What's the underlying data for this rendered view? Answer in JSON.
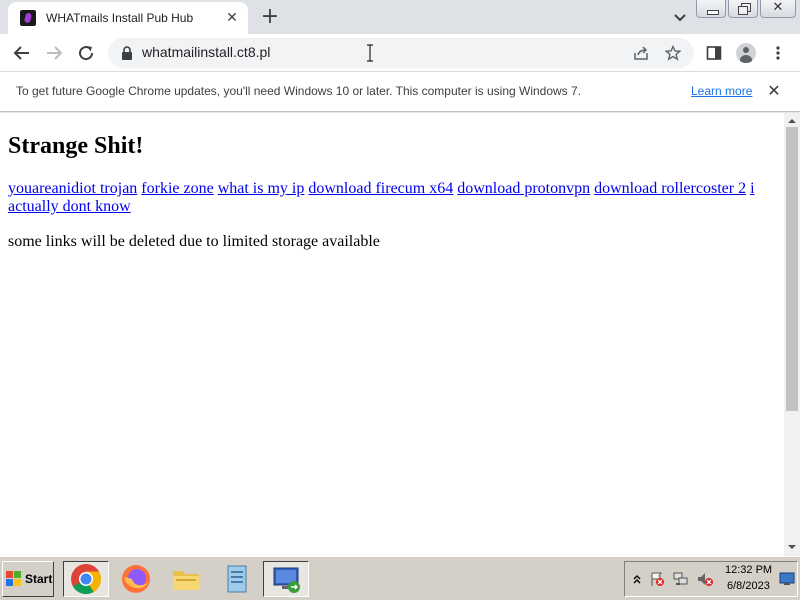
{
  "browser": {
    "tab": {
      "title": "WHATmails Install Pub Hub",
      "close_glyph": "✕",
      "favicon": "site-favicon"
    },
    "new_tab_glyph": "+",
    "window_controls": {
      "close_glyph": "✕"
    },
    "address_bar": {
      "url": "whatmailinstall.ct8.pl"
    },
    "infobar": {
      "message": "To get future Google Chrome updates, you'll need Windows 10 or later. This computer is using Windows 7.",
      "link_label": "Learn more",
      "close_glyph": "✕"
    },
    "colors": {
      "accent": "#1a73e8",
      "tabstrip": "#dee1e6",
      "link": "#0000ee"
    }
  },
  "page": {
    "title": "Strange Shit!",
    "links": [
      "youareanidiot trojan",
      "forkie zone",
      "what is my ip",
      "download firecum x64",
      "download protonvpn",
      "download rollercoster 2",
      "i actually dont know"
    ],
    "note": "some links will be deleted due to limited storage available"
  },
  "taskbar": {
    "start_label": "Start",
    "apps": [
      "chrome-icon",
      "firefox-icon",
      "explorer-folder-icon",
      "notepad-icon",
      "remote-desktop-icon"
    ],
    "tray": {
      "time": "12:32 PM",
      "date": "6/8/2023",
      "icons": [
        "show-hidden-icons-chevron",
        "action-center-icon",
        "network-icon",
        "volume-muted-icon",
        "show-desktop-icon"
      ]
    }
  }
}
